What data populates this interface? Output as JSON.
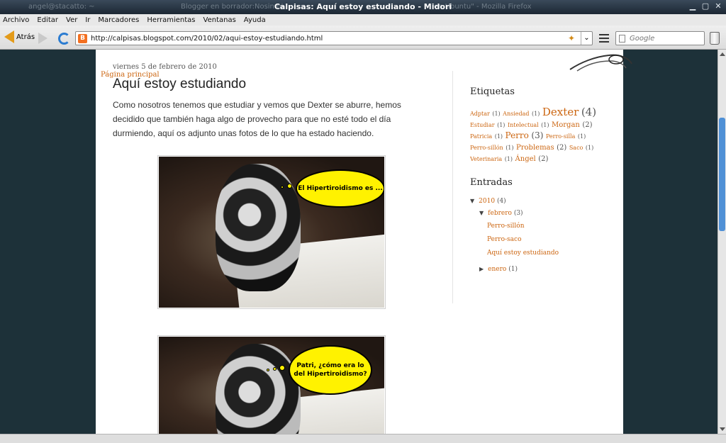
{
  "window": {
    "title": "Calpisas: Aquí estoy estudiando - Midori",
    "ghost_left": "angel@stacatto: ~",
    "ghost_mid": "Blogger en borrador:Nosinmi",
    "ghost_right": "en Ubuntu\" - Mozilla Firefox"
  },
  "menu": [
    "Archivo",
    "Editar",
    "Ver",
    "Ir",
    "Marcadores",
    "Herramientas",
    "Ventanas",
    "Ayuda"
  ],
  "toolbar": {
    "back_label": "Atrás",
    "url": "http://calpisas.blogspot.com/2010/02/aqui-estoy-estudiando.html",
    "search_placeholder": "Google"
  },
  "post": {
    "date": "viernes 5 de febrero de 2010",
    "home_link": "Página principal",
    "title": "Aquí estoy estudiando",
    "body": "Como nosotros tenemos que estudiar y vemos que Dexter se aburre, hemos decidido que también haga algo de provecho para que no esté todo el día durmiendo, aquí os adjunto unas fotos de lo que ha estado haciendo.",
    "bubble1": "El Hipertiroidismo es ...",
    "bubble2": "Patri, ¿cómo era lo del Hipertiroidismo?"
  },
  "sidebar": {
    "labels_title": "Etiquetas",
    "labels": [
      {
        "name": "Adptar",
        "count": "(1)",
        "size": 1
      },
      {
        "name": "Ansiedad",
        "count": "(1)",
        "size": 1
      },
      {
        "name": "Dexter",
        "count": "(4)",
        "size": 5
      },
      {
        "name": "Estudiar",
        "count": "(1)",
        "size": 1
      },
      {
        "name": "Intelectual",
        "count": "(1)",
        "size": 1
      },
      {
        "name": "Morgan",
        "count": "(2)",
        "size": 3
      },
      {
        "name": "Patricia",
        "count": "(1)",
        "size": 1
      },
      {
        "name": "Perro",
        "count": "(3)",
        "size": 4
      },
      {
        "name": "Perro-silla",
        "count": "(1)",
        "size": 1
      },
      {
        "name": "Perro-sillón",
        "count": "(1)",
        "size": 1
      },
      {
        "name": "Problemas",
        "count": "(2)",
        "size": 3
      },
      {
        "name": "Saco",
        "count": "(1)",
        "size": 1
      },
      {
        "name": "Veterinaria",
        "count": "(1)",
        "size": 1
      },
      {
        "name": "Ángel",
        "count": "(2)",
        "size": 3
      }
    ],
    "archive_title": "Entradas",
    "archive": {
      "year": "2010",
      "year_count": "(4)",
      "month": "febrero",
      "month_count": "(3)",
      "posts": [
        "Perro-sillón",
        "Perro-saco",
        "Aquí estoy estudiando"
      ],
      "month2": "enero",
      "month2_count": "(1)"
    }
  }
}
